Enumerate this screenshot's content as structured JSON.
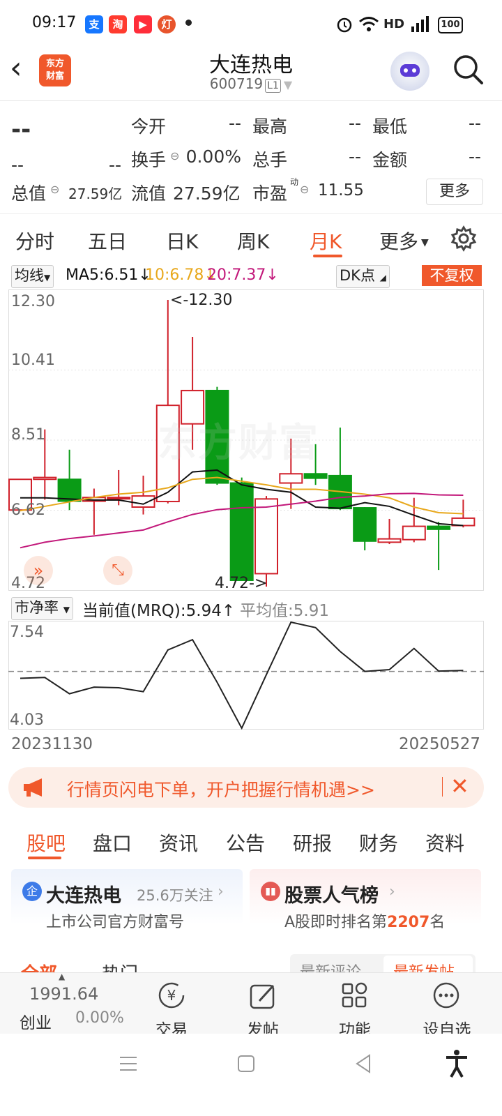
{
  "status": {
    "time": "09:17",
    "network": "HD",
    "battery": "100"
  },
  "header": {
    "logo": [
      "东方",
      "财富"
    ],
    "title": "大连热电",
    "code": "600719",
    "level": "L1"
  },
  "quote": {
    "price": "--",
    "change": "--",
    "change_pct": "--",
    "open_label": "今开",
    "open_value": "--",
    "high_label": "最高",
    "high_value": "--",
    "low_label": "最低",
    "low_value": "--",
    "turnover_label": "换手",
    "turnover_value": "0.00%",
    "volume_label": "总手",
    "volume_value": "--",
    "amount_label": "金额",
    "amount_value": "--",
    "mktcap_label": "总值",
    "mktcap_value": "27.59亿",
    "float_label": "流值",
    "float_value": "27.59亿",
    "pe_label": "市盈",
    "pe_sup": "动",
    "pe_value": "11.55",
    "more_button": "更多"
  },
  "period_tabs": {
    "items": [
      "分时",
      "五日",
      "日K",
      "周K",
      "月K",
      "更多"
    ],
    "active": "月K"
  },
  "ma_bar": {
    "select": "均线",
    "ma5": "MA5:6.51↓",
    "ma10": "10:6.78↓",
    "ma20": "20:7.37↓",
    "dk": "DK点",
    "adjust": "不复权"
  },
  "kchart": {
    "yticks": [
      "12.30",
      "10.41",
      "8.51",
      "6.62",
      "4.72"
    ],
    "max_label": "<-12.30",
    "min_label": "4.72->",
    "watermark": "东方财富"
  },
  "pb_bar": {
    "select": "市净率",
    "current": "当前值(MRQ):5.94↑",
    "avg": "平均值:5.91"
  },
  "pbchart": {
    "ymax": "7.54",
    "ymin": "4.03",
    "x_start": "20231130",
    "x_end": "20250527"
  },
  "chart_data": [
    {
      "type": "candlestick",
      "title": "",
      "ylim": [
        4.72,
        12.3
      ],
      "candles": [
        {
          "open": 6.62,
          "close": 7.45,
          "high": 7.45,
          "low": 6.62
        },
        {
          "open": 7.45,
          "close": 7.5,
          "high": 8.8,
          "low": 6.9
        },
        {
          "open": 7.45,
          "close": 6.86,
          "high": 8.25,
          "low": 6.62
        },
        {
          "open": 6.86,
          "close": 6.96,
          "high": 7.2,
          "low": 5.95
        },
        {
          "open": 6.96,
          "close": 6.96,
          "high": 7.7,
          "low": 6.75
        },
        {
          "open": 6.7,
          "close": 7.0,
          "high": 7.55,
          "low": 6.5
        },
        {
          "open": 6.85,
          "close": 9.45,
          "high": 12.3,
          "low": 6.8
        },
        {
          "open": 8.95,
          "close": 9.85,
          "high": 11.3,
          "low": 8.25
        },
        {
          "open": 9.85,
          "close": 7.35,
          "high": 9.95,
          "low": 7.3
        },
        {
          "open": 7.35,
          "close": 4.72,
          "high": 7.5,
          "low": 4.72
        },
        {
          "open": 4.9,
          "close": 6.92,
          "high": 7.0,
          "low": 4.55
        },
        {
          "open": 7.35,
          "close": 7.6,
          "high": 8.55,
          "low": 6.65
        },
        {
          "open": 7.6,
          "close": 7.48,
          "high": 8.4,
          "low": 7.3
        },
        {
          "open": 7.55,
          "close": 6.66,
          "high": 8.85,
          "low": 6.62
        },
        {
          "open": 6.68,
          "close": 5.78,
          "high": 6.7,
          "low": 5.53
        },
        {
          "open": 5.75,
          "close": 5.84,
          "high": 6.38,
          "low": 5.7
        },
        {
          "open": 5.82,
          "close": 6.18,
          "high": 6.95,
          "low": 5.75
        },
        {
          "open": 6.18,
          "close": 6.1,
          "high": 6.3,
          "low": 5.0
        },
        {
          "open": 6.2,
          "close": 6.4,
          "high": 6.9,
          "low": 6.15
        }
      ],
      "series": [
        {
          "values": [
            6.95,
            6.95,
            6.92,
            6.89,
            6.89,
            6.78,
            7.1,
            7.65,
            7.7,
            7.3,
            7.18,
            7.1,
            6.7,
            6.67,
            6.82,
            6.72,
            6.48,
            6.25,
            6.2
          ]
        },
        {
          "values": [
            6.6,
            6.72,
            6.84,
            6.96,
            7.05,
            7.1,
            7.22,
            7.45,
            7.5,
            7.4,
            7.3,
            7.18,
            7.18,
            7.12,
            7.05,
            6.95,
            6.7,
            6.55,
            6.52
          ]
        },
        {
          "values": [
            5.6,
            5.75,
            5.85,
            5.92,
            6.0,
            6.08,
            6.3,
            6.5,
            6.63,
            6.68,
            6.7,
            6.78,
            6.86,
            6.96,
            7.0,
            7.06,
            7.07,
            7.03,
            7.02
          ]
        }
      ]
    },
    {
      "type": "line",
      "title": "",
      "x": [
        "20231130",
        "20250527"
      ],
      "ylim": [
        4.03,
        7.54
      ],
      "series": [
        {
          "values": [
            5.68,
            5.71,
            5.17,
            5.39,
            5.37,
            5.24,
            6.62,
            6.96,
            5.55,
            4.03,
            5.8,
            7.54,
            7.36,
            6.57,
            5.91,
            5.97,
            6.67,
            5.92,
            5.94
          ]
        }
      ],
      "reference_line": 5.91
    }
  ],
  "banner": {
    "text": "行情页闪电下单，开户把握行情机遇>>"
  },
  "section_tabs": {
    "items": [
      "股吧",
      "盘口",
      "资讯",
      "公告",
      "研报",
      "财务",
      "资料"
    ],
    "active": "股吧"
  },
  "cards": [
    {
      "title": "大连热电",
      "extra": "25.6万关注",
      "subtitle": "上市公司官方财富号"
    },
    {
      "title": "股票人气榜",
      "subtitle_pre": "A股即时排名第",
      "rank": "2207",
      "subtitle_post": "名"
    }
  ],
  "filter_tabs": {
    "left": [
      "全部",
      "热门"
    ],
    "right": [
      "最新评论",
      "最新发帖"
    ]
  },
  "bottom_nav": {
    "index_value": "1991.64",
    "index_name": "创业",
    "index_change": "0.00%",
    "items": [
      "交易",
      "发帖",
      "功能",
      "设自选"
    ]
  },
  "colors": {
    "accent": "#f0582b",
    "up": "#d0202a",
    "down": "#0a9b16",
    "ma5": "#111111",
    "ma10": "#e8a81c",
    "ma20": "#c2187a"
  }
}
